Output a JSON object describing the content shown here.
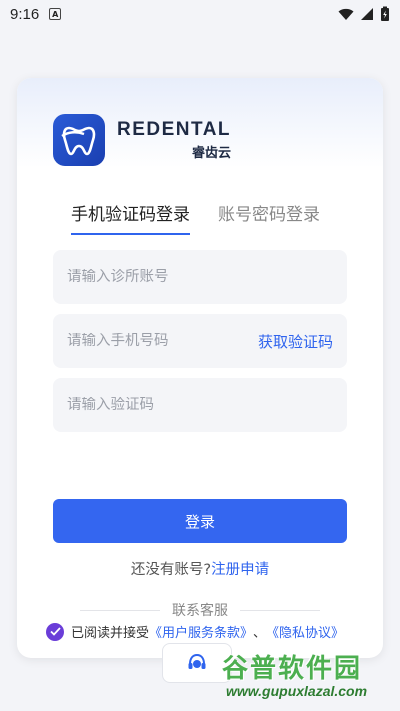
{
  "status_bar": {
    "time": "9:16",
    "notification_icon": "a-badge-icon",
    "icons": [
      "wifi-icon",
      "signal-icon",
      "battery-charging-icon"
    ]
  },
  "brand": {
    "name_en": "REDENTAL",
    "name_cn": "睿齿云",
    "logo_icon": "tooth-logo-icon"
  },
  "tabs": [
    {
      "label": "手机验证码登录",
      "active": true
    },
    {
      "label": "账号密码登录",
      "active": false
    }
  ],
  "form": {
    "clinic_account_placeholder": "请输入诊所账号",
    "phone_placeholder": "请输入手机号码",
    "get_code_label": "获取验证码",
    "code_placeholder": "请输入验证码",
    "login_label": "登录"
  },
  "register": {
    "prompt": "还没有账号?",
    "link": "注册申请"
  },
  "support": {
    "label": "联系客服",
    "icon": "headset-icon"
  },
  "agreement": {
    "checked": true,
    "prefix": "已阅读并接受",
    "terms": "《用户服务条款》",
    "separator": "、",
    "privacy": "《隐私协议》"
  },
  "watermark": {
    "title": "谷普软件园",
    "url": "www.gupuxlazal.com"
  },
  "colors": {
    "accent": "#3466f0",
    "link": "#2f64ee",
    "checkbox": "#6a3dd8",
    "watermark": "#4caf50"
  }
}
